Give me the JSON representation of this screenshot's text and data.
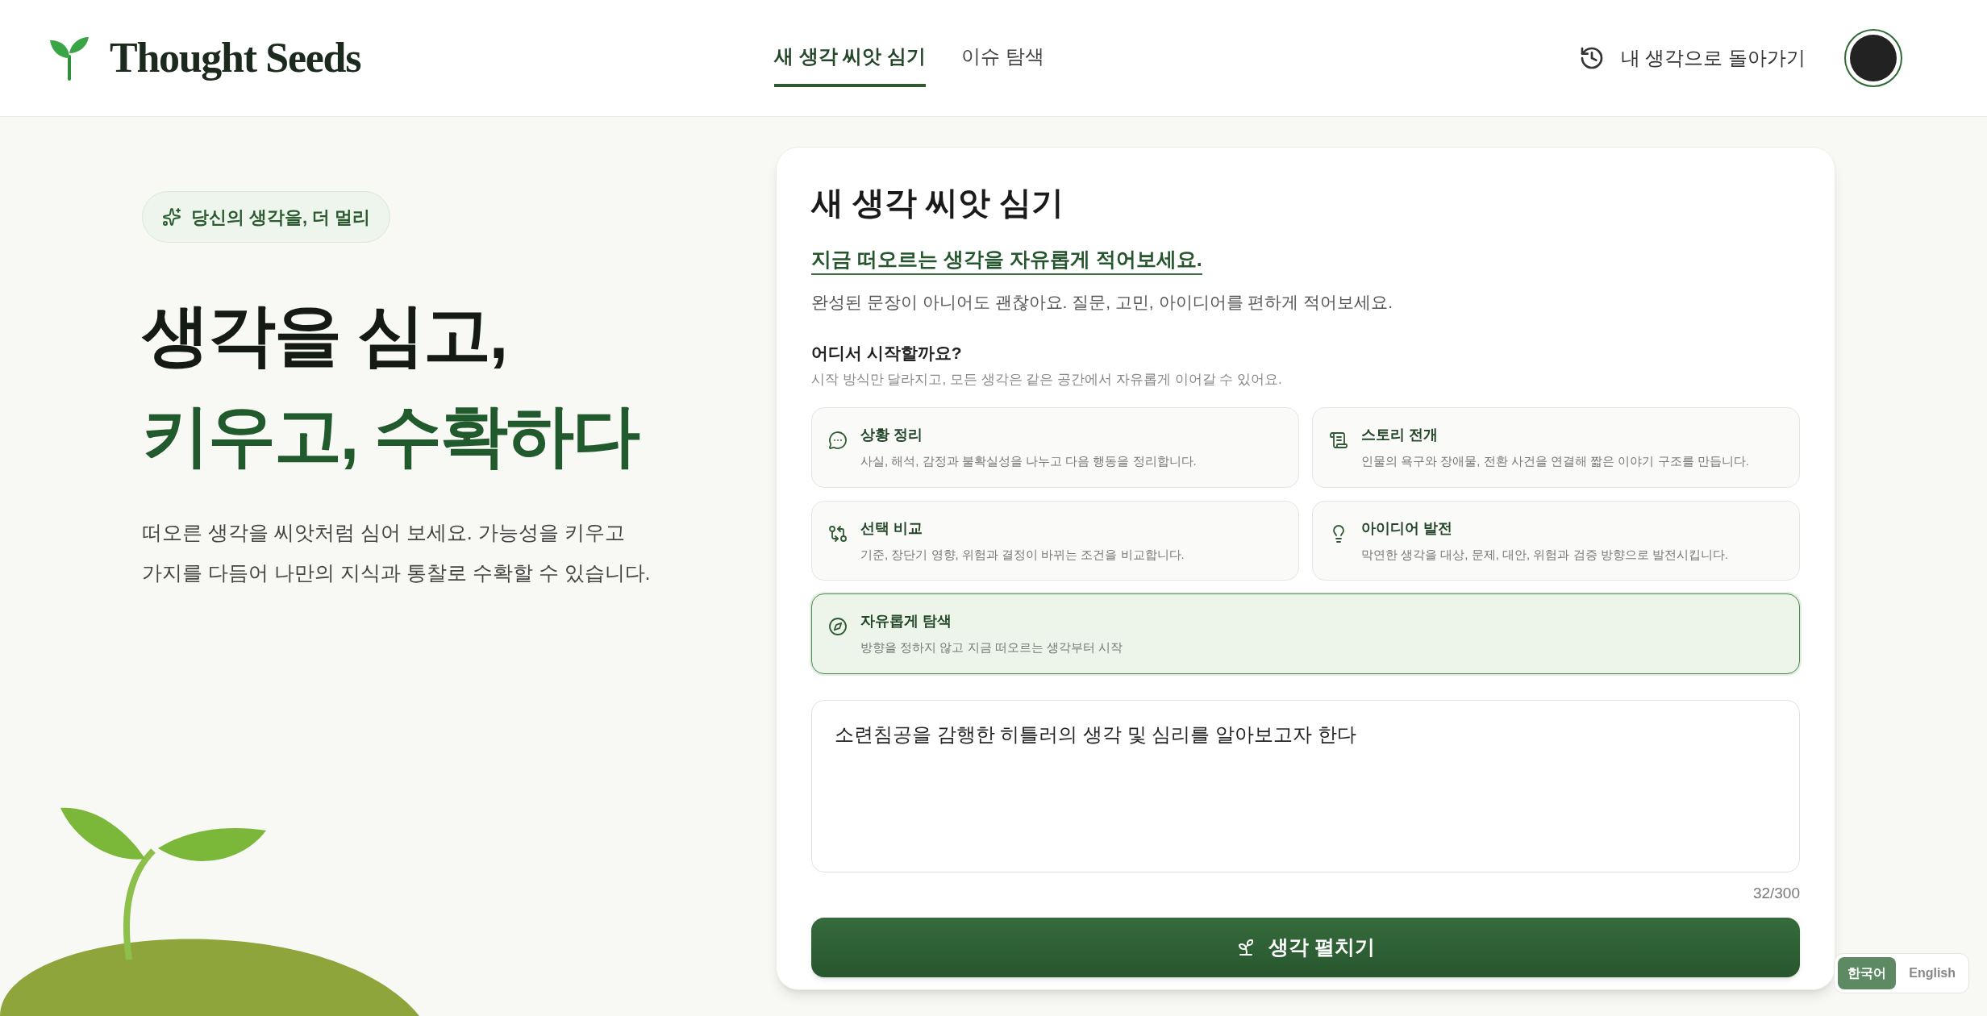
{
  "header": {
    "logo": "Thought Seeds",
    "nav": [
      {
        "label": "새 생각 씨앗 심기",
        "selected": true
      },
      {
        "label": "이슈 탐색",
        "selected": false
      }
    ],
    "back_link": "내 생각으로 돌아가기"
  },
  "hero": {
    "badge": "당신의 생각을, 더 멀리",
    "headline_1": "생각을 심고,",
    "headline_2": "키우고, 수확하다",
    "description": "떠오른 생각을 씨앗처럼 심어 보세요. 가능성을 키우고\n가지를 다듬어 나만의 지식과 통찰로 수확할 수 있습니다."
  },
  "form": {
    "title": "새 생각 씨앗 심기",
    "prompt": "지금 떠오르는 생각을 자유롭게 적어보세요.",
    "hint": "완성된 문장이 아니어도 괜찮아요. 질문, 고민, 아이디어를 편하게 적어보세요.",
    "start_label": "어디서 시작할까요?",
    "start_hint": "시작 방식만 달라지고, 모든 생각은 같은 공간에서 자유롭게 이어갈 수 있어요.",
    "options": [
      {
        "title": "상황 정리",
        "description": "사실, 해석, 감정과 불확실성을 나누고 다음 행동을 정리합니다.",
        "selected": false
      },
      {
        "title": "스토리 전개",
        "description": "인물의 욕구와 장애물, 전환 사건을 연결해 짧은 이야기 구조를 만듭니다.",
        "selected": false
      },
      {
        "title": "선택 비교",
        "description": "기준, 장단기 영향, 위험과 결정이 바뀌는 조건을 비교합니다.",
        "selected": false
      },
      {
        "title": "아이디어 발전",
        "description": "막연한 생각을 대상, 문제, 대안, 위험과 검증 방향으로 발전시킵니다.",
        "selected": false
      },
      {
        "title": "자유롭게 탐색",
        "description": "방향을 정하지 않고 지금 떠오르는 생각부터 시작",
        "selected": true
      }
    ],
    "thought": {
      "value": "소련침공을 감행한 히틀러의 생각 및 심리를 알아보고자 한다"
    },
    "counter": "32/300",
    "submit": "생각 펼치기"
  },
  "language": [
    {
      "label": "한국어",
      "selected": true
    },
    {
      "label": "English",
      "selected": false
    }
  ]
}
